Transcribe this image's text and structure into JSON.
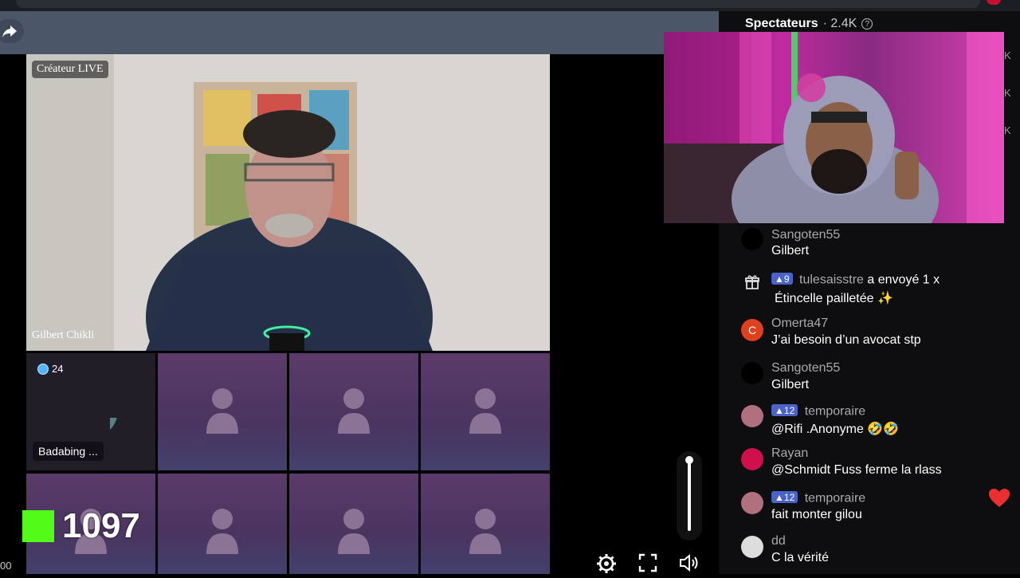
{
  "header": {
    "viewers_label": "Spectateurs",
    "viewers_count": "· 2.4K",
    "help_glyph": "?"
  },
  "side_counts": [
    "K",
    "K",
    "K"
  ],
  "main_video": {
    "badge": "Créateur LIVE",
    "name": "Gilbert Chikli"
  },
  "guest_tile": {
    "level": "24",
    "name": "Badabing ..."
  },
  "counter": {
    "value": "1097",
    "brand_color": "#53fc18"
  },
  "left_edge_text": "00",
  "controls": {
    "settings": "gear-icon",
    "fullscreen": "fullscreen-icon",
    "volume": "volume-icon"
  },
  "chat": [
    {
      "user": "Sangoten55",
      "level": "",
      "text": "Gilbert",
      "avatar_color": "#000000"
    },
    {
      "user": "tulesaisstre",
      "level": "9",
      "action": "a envoyé 1 x",
      "text": "Étincelle pailletée ✨",
      "avatar_color": "gift"
    },
    {
      "user": "Omerta47",
      "level": "",
      "text": "J’ai besoin d’un avocat stp",
      "avatar_color": "#e0401e",
      "initial": "C"
    },
    {
      "user": "Sangoten55",
      "level": "",
      "text": "Gilbert",
      "avatar_color": "#000000"
    },
    {
      "user": "temporaire",
      "level": "12",
      "text": "@Rifi .Anonyme 🤣🤣",
      "avatar_color": "#b07080"
    },
    {
      "user": "Rayan",
      "level": "",
      "text": "@Schmidt Fuss ferme la rlass",
      "avatar_color": "#d0104a"
    },
    {
      "user": "temporaire",
      "level": "12",
      "text": "fait monter gilou",
      "avatar_color": "#b07080"
    },
    {
      "user": "dd",
      "level": "",
      "text": "C la vérité",
      "avatar_color": "#dddddd"
    }
  ]
}
